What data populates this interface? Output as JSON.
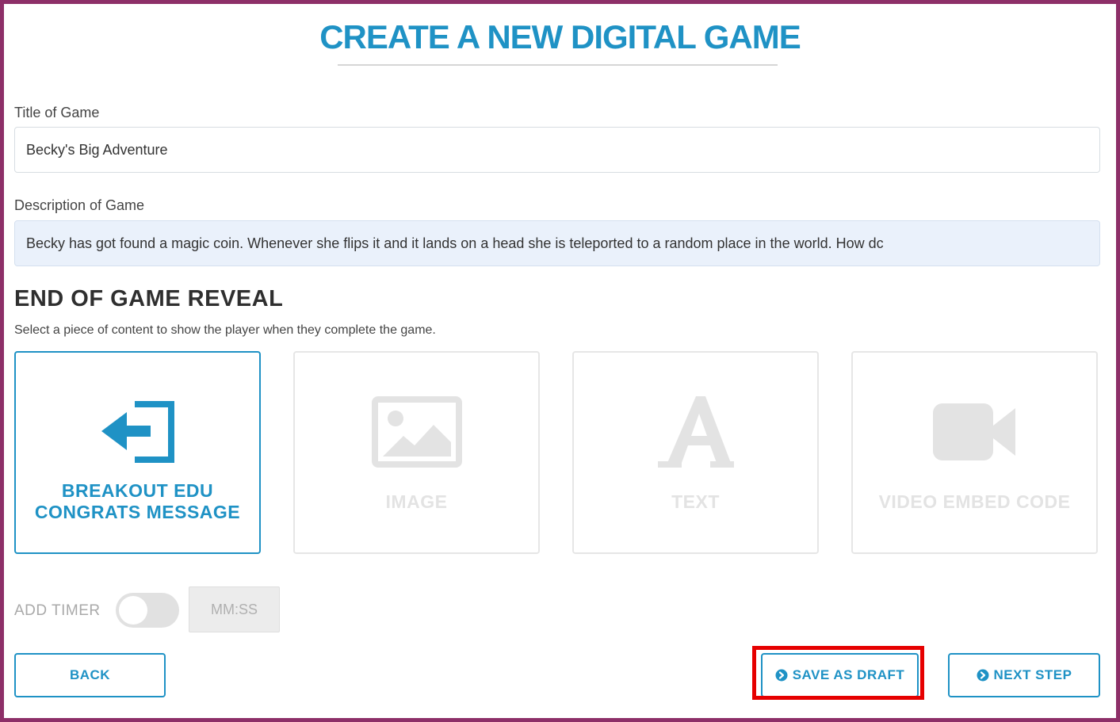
{
  "header": {
    "title": "CREATE A NEW DIGITAL GAME"
  },
  "form": {
    "title_label": "Title of Game",
    "title_value": "Becky's Big Adventure",
    "description_label": "Description of Game",
    "description_value": "Becky has got found a magic coin.  Whenever she flips it and it lands on a head she is teleported to a random place in the world.  How dc"
  },
  "reveal": {
    "heading": "END OF GAME REVEAL",
    "subtitle": "Select a piece of content to show the player when they complete the game.",
    "options": [
      {
        "label": "BREAKOUT EDU CONGRATS MESSAGE",
        "icon": "exit-arrow-icon",
        "selected": true
      },
      {
        "label": "IMAGE",
        "icon": "image-icon",
        "selected": false
      },
      {
        "label": "TEXT",
        "icon": "text-letter-a-icon",
        "selected": false
      },
      {
        "label": "VIDEO EMBED CODE",
        "icon": "video-camera-icon",
        "selected": false
      }
    ]
  },
  "timer": {
    "label": "ADD TIMER",
    "enabled": false,
    "placeholder": "MM:SS"
  },
  "actions": {
    "back_label": "BACK",
    "save_draft_label": "SAVE AS DRAFT",
    "next_step_label": "NEXT STEP"
  },
  "colors": {
    "accent": "#1f92c5",
    "frame": "#8d2f68",
    "highlight": "#e60000",
    "disabled": "#e3e3e3"
  }
}
